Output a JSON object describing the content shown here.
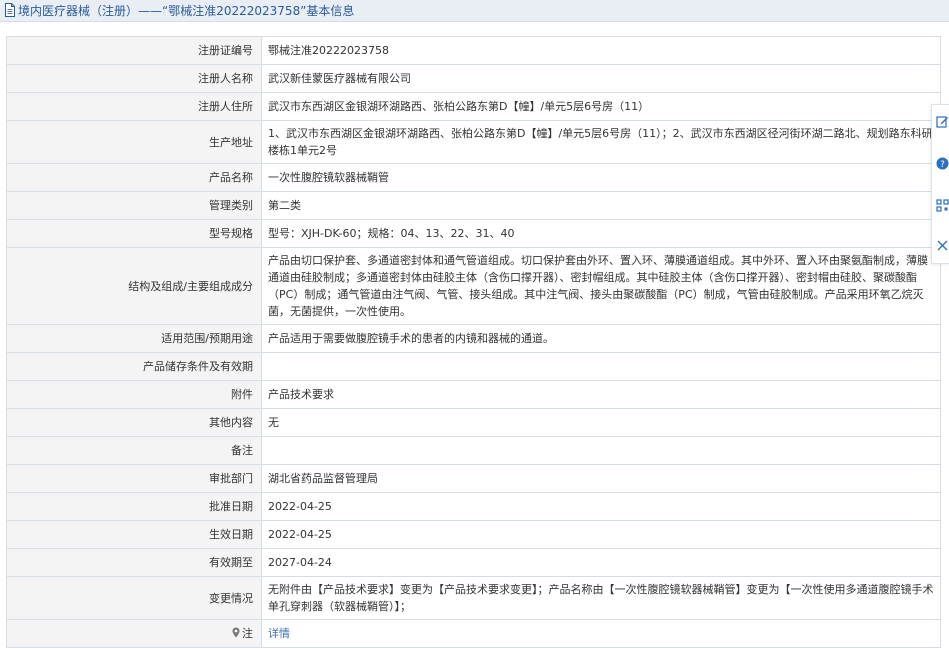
{
  "header": {
    "title": "境内医疗器械（注册）——“鄂械注准20222023758”基本信息"
  },
  "rows": [
    {
      "label": "注册证编号",
      "value": "鄂械注准20222023758"
    },
    {
      "label": "注册人名称",
      "value": "武汉新佳蒙医疗器械有限公司"
    },
    {
      "label": "注册人住所",
      "value": "武汉市东西湖区金银湖环湖路西、张柏公路东第D【幢】/单元5层6号房（11）"
    },
    {
      "label": "生产地址",
      "value": "1、武汉市东西湖区金银湖环湖路西、张柏公路东第D【幢】/单元5层6号房（11）；2、武汉市东西湖区径河街环湖二路北、规划路东科研楼栋1单元2号"
    },
    {
      "label": "产品名称",
      "value": "一次性腹腔镜软器械鞘管"
    },
    {
      "label": "管理类别",
      "value": "第二类"
    },
    {
      "label": "型号规格",
      "value": "型号：XJH-DK-60；规格：04、13、22、31、40"
    },
    {
      "label": "结构及组成/主要组成成分",
      "value": "产品由切口保护套、多通道密封体和通气管道组成。切口保护套由外环、置入环、薄膜通道组成。其中外环、置入环由聚氨酯制成，薄膜通道由硅胶制成；多通道密封体由硅胶主体（含伤口撑开器）、密封帽组成。其中硅胶主体（含伤口撑开器）、密封帽由硅胶、聚碳酸酯（PC）制成；通气管道由注气阀、气管、接头组成。其中注气阀、接头由聚碳酸酯（PC）制成，气管由硅胶制成。产品采用环氧乙烷灭菌，无菌提供，一次性使用。"
    },
    {
      "label": "适用范围/预期用途",
      "value": "产品适用于需要做腹腔镜手术的患者的内镜和器械的通道。"
    },
    {
      "label": "产品储存条件及有效期",
      "value": ""
    },
    {
      "label": "附件",
      "value": "产品技术要求"
    },
    {
      "label": "其他内容",
      "value": "无"
    },
    {
      "label": "备注",
      "value": ""
    },
    {
      "label": "审批部门",
      "value": "湖北省药品监督管理局"
    },
    {
      "label": "批准日期",
      "value": "2022-04-25"
    },
    {
      "label": "生效日期",
      "value": "2022-04-25"
    },
    {
      "label": "有效期至",
      "value": "2027-04-24"
    },
    {
      "label": "变更情况",
      "value": "无附件由【产品技术要求】变更为【产品技术要求变更】；产品名称由【一次性腹腔镜软器械鞘管】变更为【一次性使用多通道腹腔镜手术单孔穿刺器（软器械鞘管）】；"
    }
  ],
  "note_row": {
    "label": "注",
    "link_text": "详情"
  },
  "icons": {
    "header": "document-icon",
    "note": "pin-icon",
    "toolbar": [
      "edit-icon",
      "help-icon",
      "qr-code-icon",
      "close-icon"
    ]
  },
  "colors": {
    "header_bg": "#e9eef5",
    "title_text": "#2a5a9b",
    "label_bg": "#f4f4f4",
    "border": "#d7dde6",
    "link": "#3a6fb5",
    "toolbar_icon": "#2a6fbf"
  }
}
